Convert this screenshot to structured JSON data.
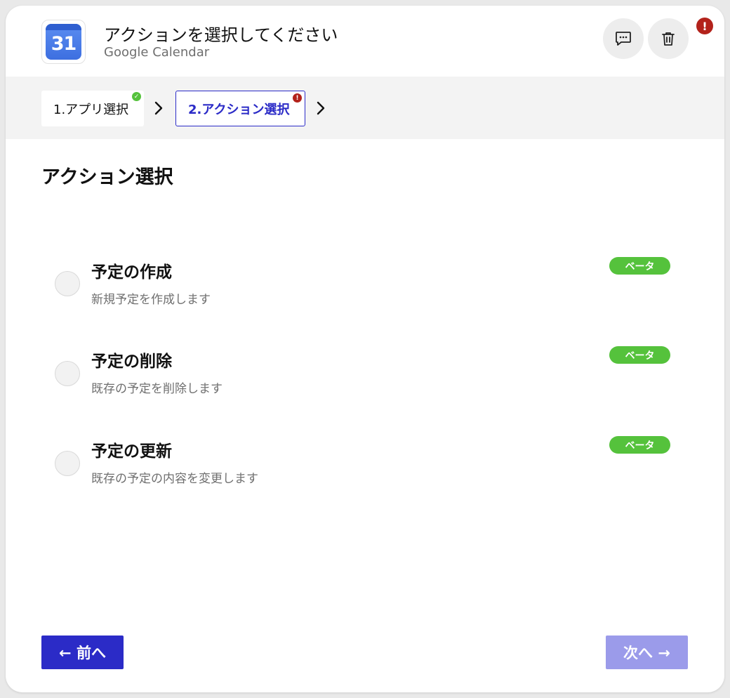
{
  "header": {
    "app_icon_text": "31",
    "title": "アクションを選択してください",
    "subtitle": "Google Calendar",
    "error_badge": "!"
  },
  "steps": [
    {
      "label": "1.アプリ選択",
      "status": "complete",
      "badge": "✓"
    },
    {
      "label": "2.アクション選択",
      "status": "error",
      "badge": "!"
    }
  ],
  "section": {
    "title": "アクション選択"
  },
  "options": [
    {
      "title": "予定の作成",
      "description": "新規予定を作成します",
      "badge": "ベータ"
    },
    {
      "title": "予定の削除",
      "description": "既存の予定を削除します",
      "badge": "ベータ"
    },
    {
      "title": "予定の更新",
      "description": "既存の予定の内容を変更します",
      "badge": "ベータ"
    }
  ],
  "footer": {
    "prev_label": "← 前へ",
    "next_label": "次へ →"
  },
  "icons": {
    "comment": "comment-icon",
    "trash": "trash-icon",
    "chevron": "chevron-right-icon"
  },
  "colors": {
    "primary": "#2b2bc7",
    "primary_disabled": "#9b9bea",
    "success": "#55c23c",
    "error": "#b3221b"
  }
}
